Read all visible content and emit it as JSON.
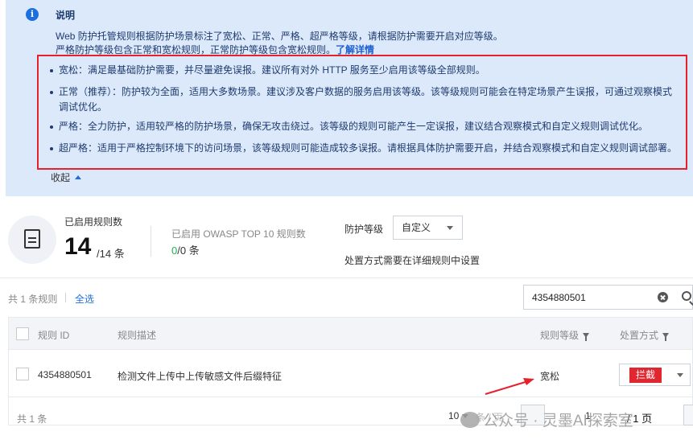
{
  "notice": {
    "title": "说明",
    "line1": "Web 防护托管规则根据防护场景标注了宽松、正常、严格、超严格等级，请根据防护需要开启对应等级。",
    "line2": "严格防护等级包含正常和宽松规则，正常防护等级包含宽松规则。",
    "learn_more": "了解详情",
    "levels": [
      {
        "text": "宽松：满足最基础防护需要，并尽量避免误报。建议所有对外 HTTP 服务至少启用该等级全部规则。"
      },
      {
        "text": "正常（推荐）：防护较为全面，适用大多数场景。建议涉及客户数据的服务启用该等级。该等级规则可能会在特定场景产生误报，可通过观察模式调试优化。"
      },
      {
        "text": "严格：全力防护，适用较严格的防护场景，确保无攻击绕过。该等级的规则可能产生一定误报，建议结合观察模式和自定义规则调试优化。"
      },
      {
        "text": "超严格：适用于严格控制环境下的访问场景，该等级规则可能造成较多误报。请根据具体防护需要开启，并结合观察模式和自定义规则调试部署。"
      }
    ],
    "collapse_label": "收起",
    "highlight_color": "#e5212a"
  },
  "stats": {
    "enabled_label": "已启用规则数",
    "enabled_count": "14",
    "enabled_total": "/14",
    "enabled_unit": "条",
    "owasp_label": "已启用 OWASP TOP 10 规则数",
    "owasp_count": "0",
    "owasp_total": "/0",
    "owasp_unit": "条"
  },
  "protection": {
    "label": "防护等级",
    "selected": "自定义",
    "hint": "处置方式需要在详细规则中设置"
  },
  "toolbar": {
    "total_rules": "共 1 条规则",
    "select_all": "全选",
    "search_value": "4354880501"
  },
  "table": {
    "headers": {
      "rule_id": "规则 ID",
      "description": "规则描述",
      "level": "规则等级",
      "action": "处置方式"
    },
    "rows": [
      {
        "rule_id": "4354880501",
        "description": "检测文件上传中上传敏感文件后缀特征",
        "level": "宽松",
        "action": "拦截"
      }
    ]
  },
  "pagination": {
    "total": "共 1 条",
    "page_size": "10",
    "page_unit": "条 / 页",
    "current_page": "1",
    "page_total": "/ 1 页"
  },
  "watermark": {
    "text": "公众号 · 灵墨AI探索室"
  },
  "colors": {
    "accent": "#1d6fe0",
    "notice_bg": "#dce9fb",
    "block_tag": "#e0262e",
    "success": "#1eb351"
  }
}
